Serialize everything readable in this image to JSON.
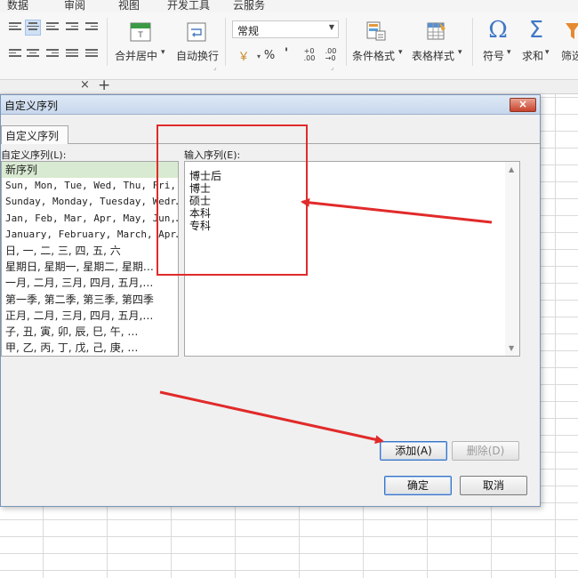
{
  "menu": [
    "数据",
    "审阅",
    "视图",
    "开发工具",
    "云服务"
  ],
  "ribbon": {
    "number_format": "常规",
    "merge_center": "合并居中",
    "auto_wrap": "自动换行",
    "conditional_format": "条件格式",
    "table_style": "表格样式",
    "symbol": "符号",
    "sum": "求和",
    "filter": "筛选",
    "percent": "%",
    "thousands": "'",
    "currency_icon": "currency-icon",
    "omega": "Ω",
    "sigma": "Σ"
  },
  "sheet_tabs": {
    "close": "×",
    "add": "+"
  },
  "dialog": {
    "title": "自定义序列",
    "close": "×",
    "tab": "自定义序列",
    "list_label": "自定义序列(L):",
    "entry_label": "输入序列(E):",
    "lists": [
      "新序列",
      "Sun, Mon, Tue, Wed, Thu, Fri, …",
      "Sunday, Monday, Tuesday, Wedr…",
      "Jan, Feb, Mar, Apr, May, Jun,…",
      "January, February, March, Apr…",
      "日, 一, 二, 三, 四, 五, 六",
      "星期日, 星期一, 星期二, 星期…",
      "一月, 二月, 三月, 四月, 五月,…",
      "第一季, 第二季, 第三季, 第四季",
      "正月, 二月, 三月, 四月, 五月,…",
      "子, 丑, 寅, 卯, 辰, 巳, 午, …",
      "甲, 乙, 丙, 丁, 戊, 己, 庚, …"
    ],
    "entries": [
      "博士后",
      "博士",
      "硕士",
      "本科",
      "专科"
    ],
    "add_button": "添加(A)",
    "delete_button": "删除(D)",
    "ok_button": "确定",
    "cancel_button": "取消"
  },
  "colors": {
    "annotation_red": "#e12a2a",
    "selected_row": "#d8ead1"
  }
}
